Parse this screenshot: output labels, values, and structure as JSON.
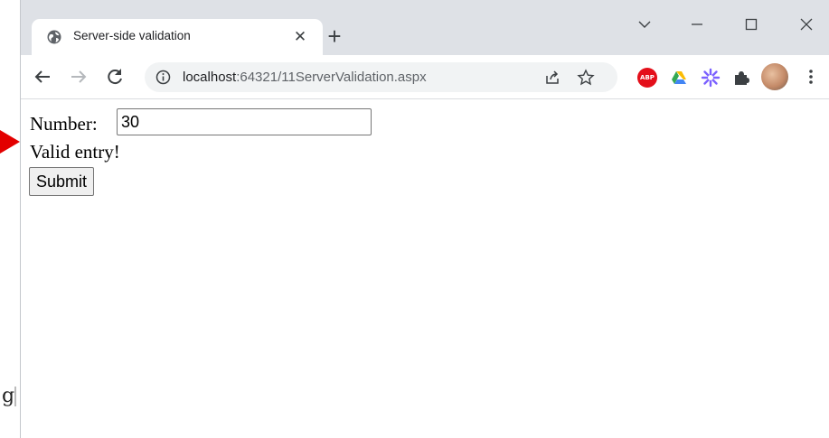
{
  "browser": {
    "tab": {
      "title": "Server-side validation",
      "close_glyph": "✕",
      "favicon": "globe-icon"
    },
    "new_tab_glyph": "+",
    "window_controls": [
      "chevron-down-icon",
      "minimize-icon",
      "maximize-icon",
      "close-icon"
    ],
    "nav": [
      "back-arrow-icon",
      "forward-arrow-icon",
      "reload-icon"
    ],
    "address": {
      "host": "localhost",
      "rest": ":64321/11ServerValidation.aspx"
    },
    "omnibox_actions": [
      "share-icon",
      "bookmark-star-icon"
    ],
    "extensions": {
      "abp_label": "ABP",
      "items": [
        "adblock-plus-icon",
        "google-drive-icon",
        "purple-spark-icon",
        "puzzle-piece-icon"
      ]
    },
    "menu": "three-dots-menu-icon"
  },
  "page": {
    "number_label": "Number:",
    "number_value": "30",
    "validation_message": "Valid entry!",
    "submit_label": "Submit"
  },
  "stray": {
    "left_glyph": "g"
  },
  "colors": {
    "tabstrip": "#dee1e6",
    "annotation_arrow": "#e30000"
  }
}
